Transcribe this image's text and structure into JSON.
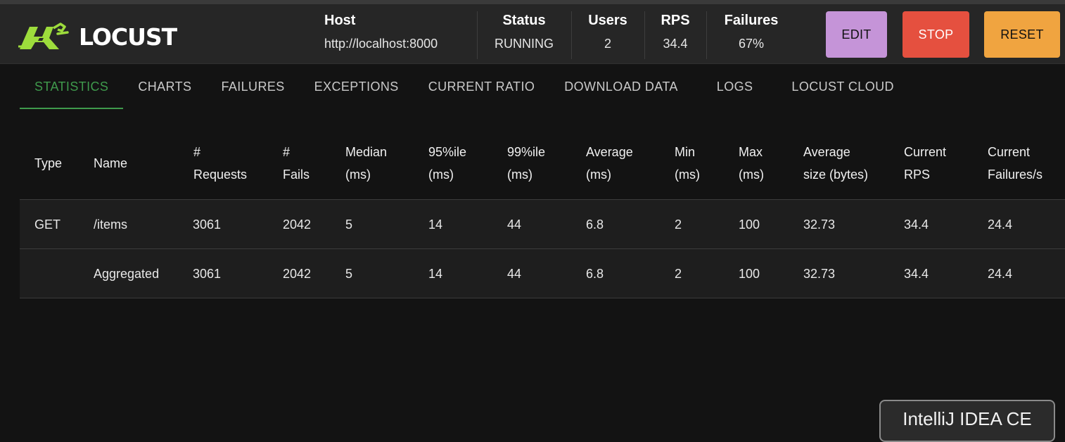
{
  "header": {
    "logo_text": "LOCUST",
    "host": {
      "label": "Host",
      "value": "http://localhost:8000"
    },
    "status": {
      "label": "Status",
      "value": "RUNNING"
    },
    "users": {
      "label": "Users",
      "value": "2"
    },
    "rps": {
      "label": "RPS",
      "value": "34.4"
    },
    "failures": {
      "label": "Failures",
      "value": "67%"
    },
    "buttons": {
      "edit": "EDIT",
      "stop": "STOP",
      "reset": "RESET"
    }
  },
  "tabs": [
    {
      "label": "STATISTICS",
      "active": true
    },
    {
      "label": "CHARTS"
    },
    {
      "label": "FAILURES"
    },
    {
      "label": "EXCEPTIONS"
    },
    {
      "label": "CURRENT RATIO"
    },
    {
      "label": "DOWNLOAD DATA"
    },
    {
      "label": "LOGS"
    },
    {
      "label": "LOCUST CLOUD"
    }
  ],
  "table": {
    "columns": [
      {
        "l1": "Type",
        "l2": ""
      },
      {
        "l1": "Name",
        "l2": ""
      },
      {
        "l1": "#",
        "l2": "Requests"
      },
      {
        "l1": "#",
        "l2": "Fails"
      },
      {
        "l1": "Median",
        "l2": "(ms)"
      },
      {
        "l1": "95%ile",
        "l2": "(ms)"
      },
      {
        "l1": "99%ile",
        "l2": "(ms)"
      },
      {
        "l1": "Average",
        "l2": "(ms)"
      },
      {
        "l1": "Min",
        "l2": "(ms)"
      },
      {
        "l1": "Max",
        "l2": "(ms)"
      },
      {
        "l1": "Average",
        "l2": "size (bytes)"
      },
      {
        "l1": "Current",
        "l2": "RPS"
      },
      {
        "l1": "Current",
        "l2": "Failures/s"
      }
    ],
    "rows": [
      [
        "GET",
        "/items",
        "3061",
        "2042",
        "5",
        "14",
        "44",
        "6.8",
        "2",
        "100",
        "32.73",
        "34.4",
        "24.4"
      ],
      [
        "",
        "Aggregated",
        "3061",
        "2042",
        "5",
        "14",
        "44",
        "6.8",
        "2",
        "100",
        "32.73",
        "34.4",
        "24.4"
      ]
    ]
  },
  "tooltip": {
    "text": "IntelliJ IDEA CE"
  },
  "colors": {
    "accent_green": "#3f9a4c",
    "logo_green": "#9ddc3c",
    "edit": "#c594d8",
    "stop": "#e5503f",
    "reset": "#f0a440"
  }
}
